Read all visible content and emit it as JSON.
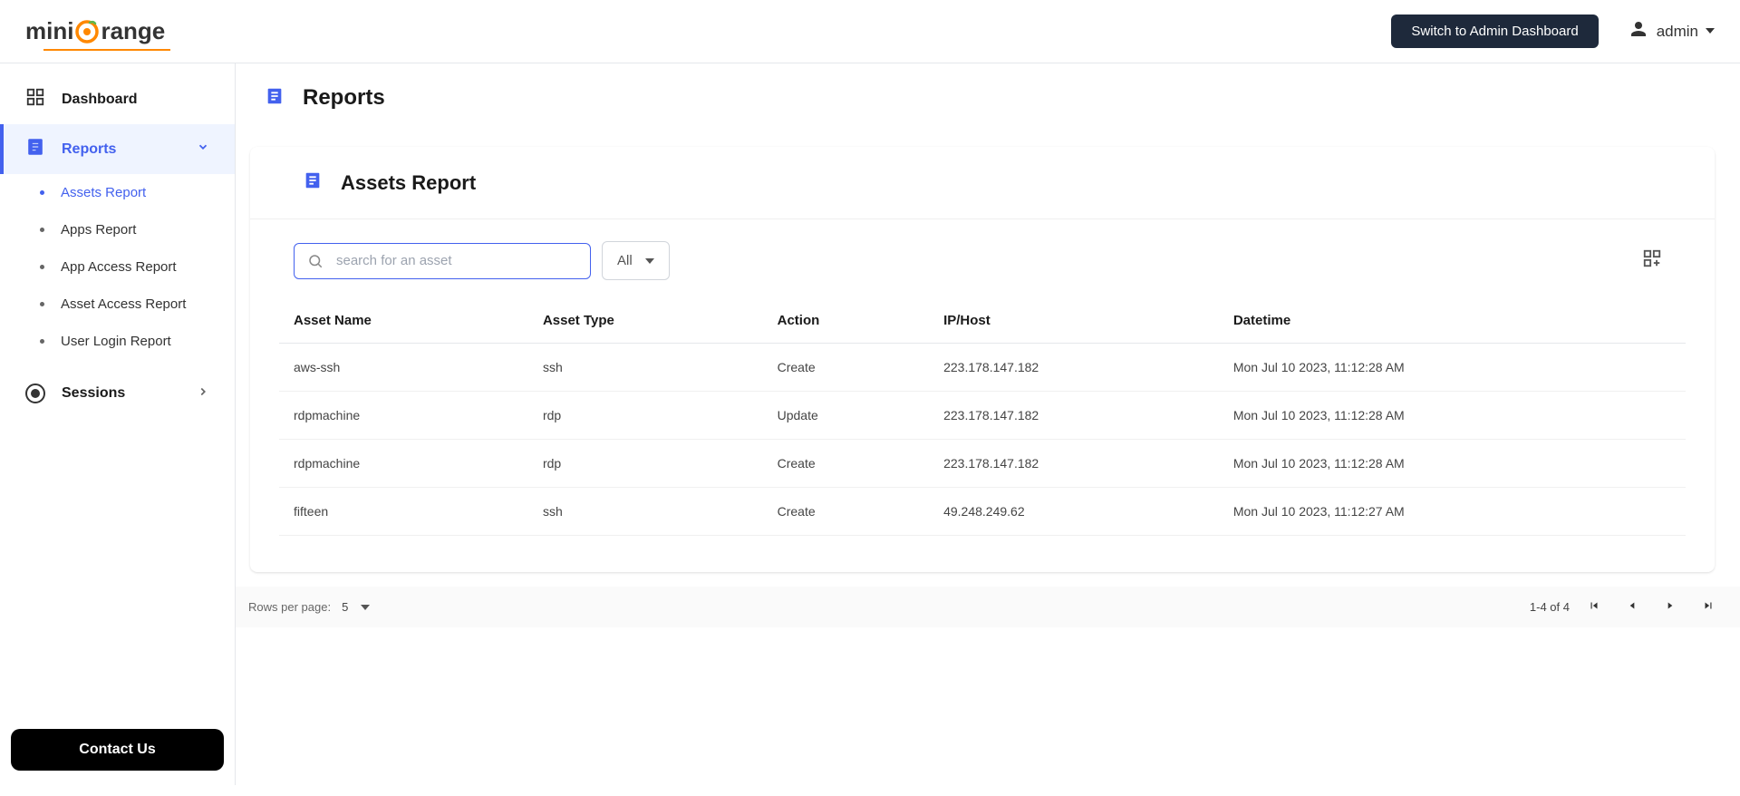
{
  "header": {
    "logo": {
      "prefix": "mini",
      "orange_char": "🍊",
      "suffix": "range"
    },
    "switch_label": "Switch to Admin Dashboard",
    "user_name": "admin"
  },
  "sidebar": {
    "items": [
      {
        "label": "Dashboard"
      },
      {
        "label": "Reports"
      },
      {
        "label": "Sessions"
      }
    ],
    "reports_sub": [
      {
        "label": "Assets Report"
      },
      {
        "label": "Apps Report"
      },
      {
        "label": "App Access Report"
      },
      {
        "label": "Asset Access Report"
      },
      {
        "label": "User Login Report"
      }
    ],
    "contact_label": "Contact Us"
  },
  "page": {
    "title": "Reports",
    "card_title": "Assets Report",
    "search": {
      "placeholder": "search for an asset"
    },
    "filter": {
      "selected": "All"
    }
  },
  "table": {
    "columns": [
      "Asset Name",
      "Asset Type",
      "Action",
      "IP/Host",
      "Datetime"
    ],
    "rows": [
      {
        "name": "aws-ssh",
        "type": "ssh",
        "action": "Create",
        "ip": "223.178.147.182",
        "datetime": "Mon Jul 10 2023, 11:12:28 AM"
      },
      {
        "name": "rdpmachine",
        "type": "rdp",
        "action": "Update",
        "ip": "223.178.147.182",
        "datetime": "Mon Jul 10 2023, 11:12:28 AM"
      },
      {
        "name": "rdpmachine",
        "type": "rdp",
        "action": "Create",
        "ip": "223.178.147.182",
        "datetime": "Mon Jul 10 2023, 11:12:28 AM"
      },
      {
        "name": "fifteen",
        "type": "ssh",
        "action": "Create",
        "ip": "49.248.249.62",
        "datetime": "Mon Jul 10 2023, 11:12:27 AM"
      }
    ]
  },
  "pagination": {
    "rows_label": "Rows per page:",
    "rows_value": "5",
    "range": "1-4 of 4"
  }
}
